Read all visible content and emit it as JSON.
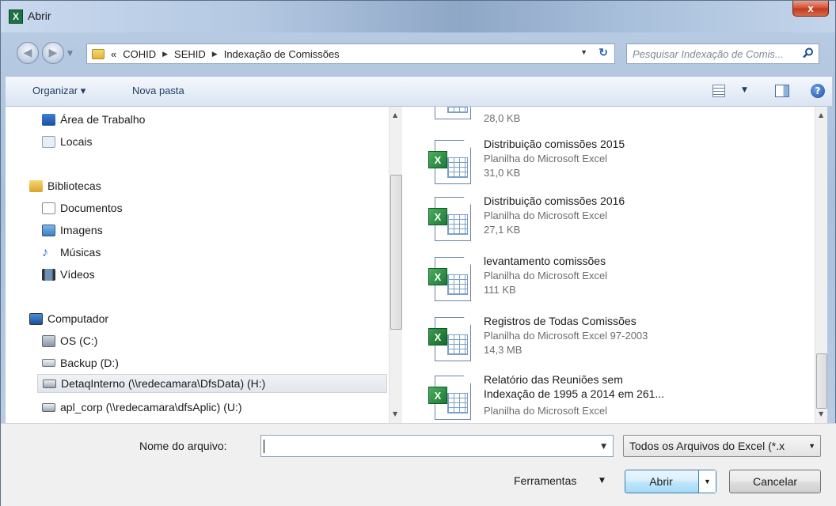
{
  "window": {
    "title": "Abrir",
    "close_label": "x"
  },
  "address": {
    "overflow": "«",
    "crumbs": [
      "COHID",
      "SEHID",
      "Indexação de Comissões"
    ],
    "search_placeholder": "Pesquisar Indexação de Comis..."
  },
  "toolbar": {
    "organize": "Organizar ▾",
    "new_folder": "Nova pasta",
    "help": "?"
  },
  "nav": {
    "items": [
      {
        "label": "Área de Trabalho",
        "icon": "desktop-icon"
      },
      {
        "label": "Locais",
        "icon": "recent-places-icon"
      },
      {
        "label": "Bibliotecas",
        "icon": "libraries-icon"
      },
      {
        "label": "Documentos",
        "icon": "documents-icon"
      },
      {
        "label": "Imagens",
        "icon": "pictures-icon"
      },
      {
        "label": "Músicas",
        "icon": "music-icon"
      },
      {
        "label": "Vídeos",
        "icon": "videos-icon"
      },
      {
        "label": "Computador",
        "icon": "computer-icon"
      },
      {
        "label": "OS (C:)",
        "icon": "drive-icon"
      },
      {
        "label": "Backup (D:)",
        "icon": "drive-icon"
      },
      {
        "label": "DetaqInterno (\\\\redecamara\\DfsData) (H:)",
        "icon": "network-drive-icon"
      },
      {
        "label": "apl_corp (\\\\redecamara\\dfsAplic) (U:)",
        "icon": "network-drive-icon"
      }
    ]
  },
  "files": [
    {
      "name": "",
      "type": "",
      "size": "28,0 KB"
    },
    {
      "name": "Distribuição comissões 2015",
      "type": "Planilha do Microsoft Excel",
      "size": "31,0 KB"
    },
    {
      "name": "Distribuição comissões 2016",
      "type": "Planilha do Microsoft Excel",
      "size": "27,1 KB"
    },
    {
      "name": "levantamento comissões",
      "type": "Planilha do Microsoft Excel",
      "size": "111 KB"
    },
    {
      "name": "Registros de Todas Comissões",
      "type": "Planilha do Microsoft Excel 97-2003",
      "size": "14,3 MB"
    },
    {
      "name": "Relatório das Reuniões sem",
      "name2": "Indexação de 1995 a 2014 em 261...",
      "type": "Planilha do Microsoft Excel",
      "size": ""
    }
  ],
  "bottom": {
    "filename_label": "Nome do arquivo:",
    "filename_value": "",
    "filetype": "Todos os Arquivos do Excel (*.x",
    "tools": "Ferramentas",
    "open": "Abrir",
    "cancel": "Cancelar"
  },
  "colors": {
    "accent": "#3c7fb1",
    "excel_green": "#1d7a36",
    "selection": "#e2e6ec"
  }
}
